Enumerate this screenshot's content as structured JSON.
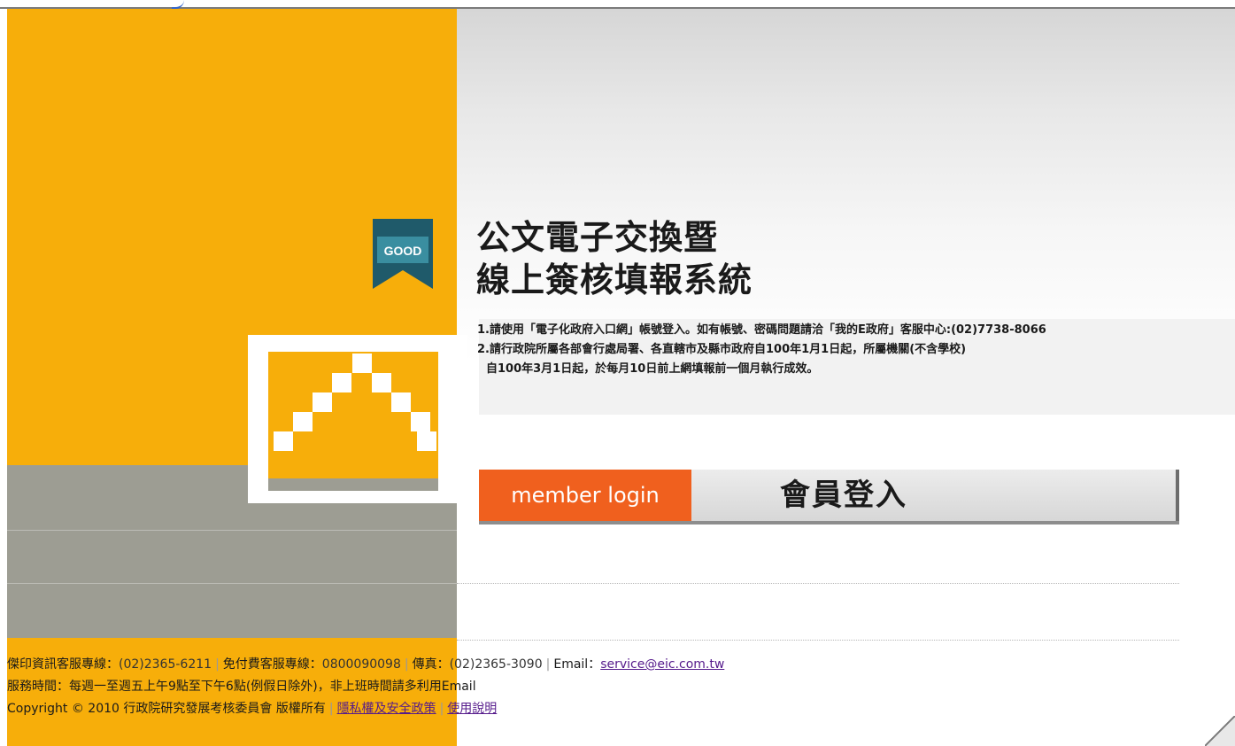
{
  "icons": {
    "good_badge": "good-badge-icon",
    "pixel_mountain": "pixel-mountain-icon"
  },
  "badge": {
    "text": "GOOD"
  },
  "title": {
    "line1": "公文電子交換暨",
    "line2": "線上簽核填報系統"
  },
  "notes": [
    "1.請使用「電子化政府入口網」帳號登入。如有帳號、密碼問題請洽「我的E政府」客服中心:(02)7738-8066",
    "2.請行政院所屬各部會行處局署、各直轄市及縣市政府自100年1月1日起，所屬機關(不含學校)",
    "自100年3月1日起，於每月10日前上網填報前一個月執行成效。"
  ],
  "login": {
    "english_label": "member login",
    "chinese_label": "會員登入"
  },
  "footer": {
    "line1": {
      "hotline_label": "傑印資訊客服專線：",
      "hotline_value": "(02)2365-6211",
      "sep1": "|",
      "tollfree_label": "免付費客服專線：",
      "tollfree_value": "0800090098",
      "sep2": "|",
      "fax_label": "傳真：",
      "fax_value": "(02)2365-3090",
      "sep3": "|",
      "email_label": "Email：",
      "email_value": "service@eic.com.tw"
    },
    "line2": "服務時間：每週一至週五上午9點至下午6點(例假日除外)，非上班時間請多利用Email",
    "line3": {
      "copyright": "Copyright © 2010 行政院研究發展考核委員會 版權所有",
      "sep": "|",
      "privacy_link": "隱私權及安全政策",
      "sep2": "|",
      "usage_link": "使用說明"
    }
  },
  "colors": {
    "orange": "#f7ae0a",
    "gray": "#9d9d93",
    "login_orange": "#f0601e"
  }
}
